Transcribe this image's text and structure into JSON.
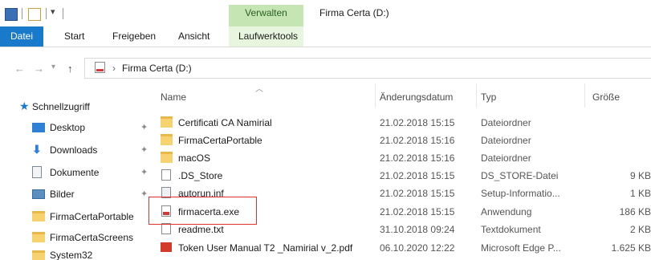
{
  "window": {
    "title": "Firma Certa (D:)",
    "context_group": "Verwalten"
  },
  "ribbon": {
    "tabs": [
      "Datei",
      "Start",
      "Freigeben",
      "Ansicht",
      "Laufwerktools"
    ]
  },
  "address": {
    "path": "Firma Certa (D:)",
    "separator": "›"
  },
  "sidebar": {
    "quick_access": "Schnellzugriff",
    "items": [
      {
        "label": "Desktop",
        "icon": "desktop-icon",
        "pinned": true
      },
      {
        "label": "Downloads",
        "icon": "download-arrow-icon",
        "pinned": true
      },
      {
        "label": "Dokumente",
        "icon": "document-icon",
        "pinned": true
      },
      {
        "label": "Bilder",
        "icon": "pictures-icon",
        "pinned": true
      },
      {
        "label": "FirmaCertaPortable",
        "icon": "folder-icon",
        "pinned": false
      },
      {
        "label": "FirmaCertaScreens",
        "icon": "folder-icon",
        "pinned": false
      },
      {
        "label": "System32",
        "icon": "folder-icon",
        "pinned": false
      }
    ]
  },
  "columns": {
    "name": "Name",
    "date": "Änderungsdatum",
    "type": "Typ",
    "size": "Größe"
  },
  "files": [
    {
      "name": "Certificati CA Namirial",
      "date": "21.02.2018 15:15",
      "type": "Dateiordner",
      "size": "",
      "icon": "folder-icon"
    },
    {
      "name": "FirmaCertaPortable",
      "date": "21.02.2018 15:16",
      "type": "Dateiordner",
      "size": "",
      "icon": "folder-icon"
    },
    {
      "name": "macOS",
      "date": "21.02.2018 15:16",
      "type": "Dateiordner",
      "size": "",
      "icon": "folder-icon"
    },
    {
      "name": ".DS_Store",
      "date": "21.02.2018 15:15",
      "type": "DS_STORE-Datei",
      "size": "9 KB",
      "icon": "file-icon"
    },
    {
      "name": "autorun.inf",
      "date": "21.02.2018 15:15",
      "type": "Setup-Informatio...",
      "size": "1 KB",
      "icon": "settings-file-icon"
    },
    {
      "name": "firmacerta.exe",
      "date": "21.02.2018 15:15",
      "type": "Anwendung",
      "size": "186 KB",
      "icon": "exe-icon"
    },
    {
      "name": "readme.txt",
      "date": "31.10.2018 09:24",
      "type": "Textdokument",
      "size": "2 KB",
      "icon": "text-file-icon"
    },
    {
      "name": "Token User Manual T2 _Namirial v_2.pdf",
      "date": "06.10.2020 12:22",
      "type": "Microsoft Edge P...",
      "size": "1.625 KB",
      "icon": "pdf-icon"
    }
  ],
  "colors": {
    "accent": "#1979ca",
    "context_tab": "#c5e6b3",
    "highlight": "#e03131"
  }
}
